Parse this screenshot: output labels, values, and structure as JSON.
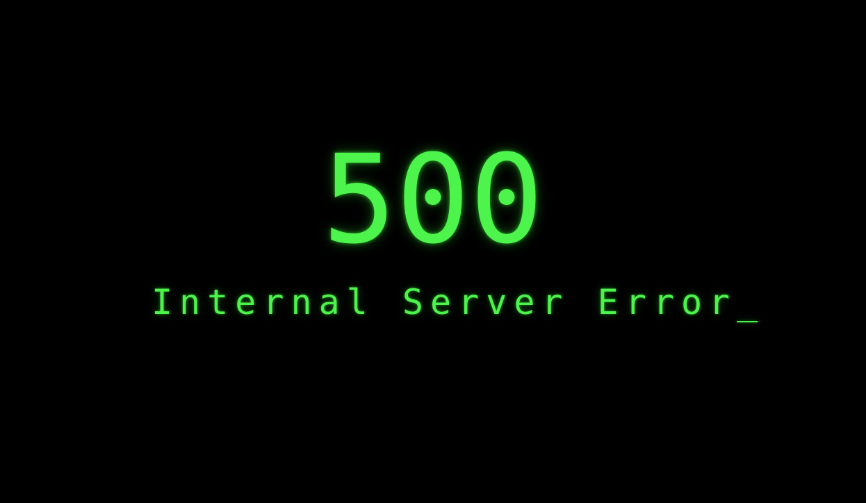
{
  "error": {
    "code": "500",
    "message": "Internal Server Error",
    "cursor": "_"
  },
  "colors": {
    "background": "#000000",
    "text": "#4cf44c"
  }
}
